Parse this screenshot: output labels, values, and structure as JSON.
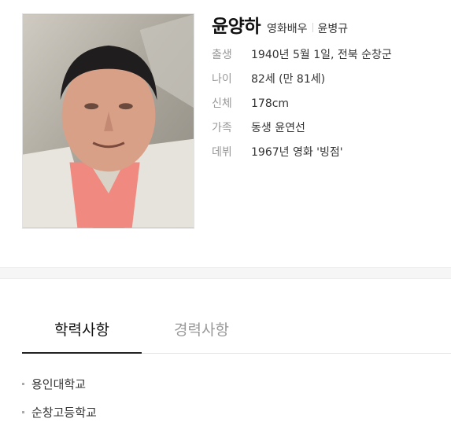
{
  "profile": {
    "name": "윤양하",
    "job": "영화배우",
    "original_name": "윤병규",
    "details": [
      {
        "label": "출생",
        "value": "1940년 5월 1일, 전북 순창군"
      },
      {
        "label": "나이",
        "value": "82세 (만 81세)"
      },
      {
        "label": "신체",
        "value": "178cm"
      },
      {
        "label": "가족",
        "value": "동생 윤연선"
      },
      {
        "label": "데뷔",
        "value": "1967년 영화 '빙점'"
      }
    ]
  },
  "tabs": [
    {
      "label": "학력사항",
      "active": true
    },
    {
      "label": "경력사항",
      "active": false
    }
  ],
  "education": [
    {
      "label": "용인대학교"
    },
    {
      "label": "순창고등학교"
    }
  ]
}
